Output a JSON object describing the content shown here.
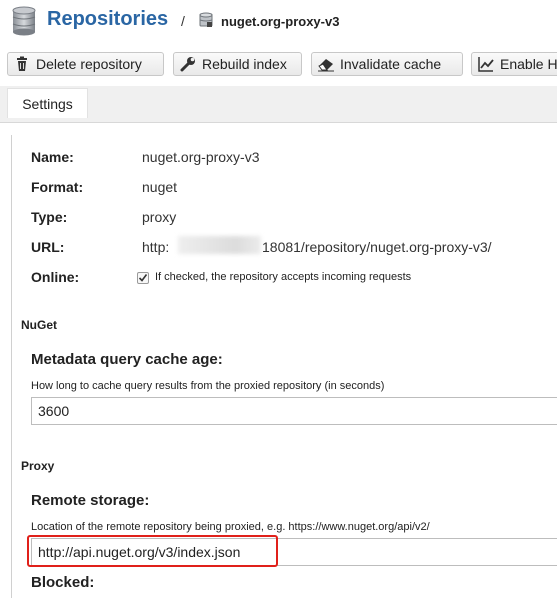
{
  "header": {
    "title": "Repositories",
    "separator": "/",
    "repository_name": "nuget.org-proxy-v3"
  },
  "toolbar": {
    "delete_label": "Delete repository",
    "rebuild_label": "Rebuild index",
    "invalidate_label": "Invalidate cache",
    "enable_label": "Enable H"
  },
  "tabs": {
    "settings_label": "Settings"
  },
  "details": {
    "name_label": "Name:",
    "name_value": "nuget.org-proxy-v3",
    "format_label": "Format:",
    "format_value": "nuget",
    "type_label": "Type:",
    "type_value": "proxy",
    "url_label": "URL:",
    "url_prefix": "http:",
    "url_suffix": "18081/repository/nuget.org-proxy-v3/",
    "online_label": "Online:",
    "online_checked": true,
    "online_help": "If checked, the repository accepts incoming requests"
  },
  "nuget": {
    "section_title": "NuGet",
    "cache_label": "Metadata query cache age:",
    "cache_help": "How long to cache query results from the proxied repository (in seconds)",
    "cache_value": "3600"
  },
  "proxy": {
    "section_title": "Proxy",
    "remote_label": "Remote storage:",
    "remote_help": "Location of the remote repository being proxied, e.g. https://www.nuget.org/api/v2/",
    "remote_value": "http://api.nuget.org/v3/index.json",
    "blocked_label": "Blocked:"
  },
  "icons": {
    "database": "database-icon",
    "repo": "repository-icon",
    "delete": "trash-icon",
    "rebuild": "wrench-icon",
    "invalidate": "eraser-icon",
    "enable": "chart-icon"
  },
  "colors": {
    "title": "#2a66a4",
    "highlight": "#e0201a"
  }
}
